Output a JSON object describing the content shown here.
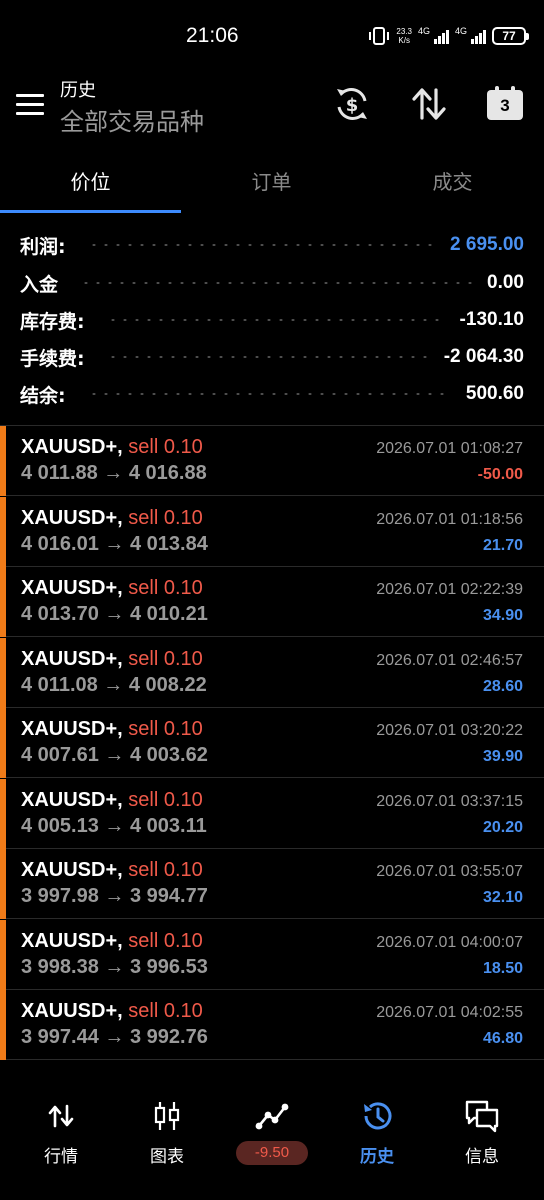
{
  "status_bar": {
    "time": "21:06",
    "speed_value": "23.3",
    "speed_unit": "K/s",
    "network1": "4G",
    "network2": "4G",
    "battery": "77"
  },
  "header": {
    "title": "历史",
    "subtitle": "全部交易品种",
    "icons": [
      "menu-icon",
      "currency-exchange-icon",
      "sort-icon",
      "calendar-icon"
    ],
    "calendar_day": "3"
  },
  "tabs": [
    {
      "label": "价位",
      "active": true
    },
    {
      "label": "订单",
      "active": false
    },
    {
      "label": "成交",
      "active": false
    }
  ],
  "summary": [
    {
      "label": "利润:",
      "value": "2 695.00",
      "color": "#4a90f0"
    },
    {
      "label": "入金",
      "value": "0.00",
      "color": "#ffffff"
    },
    {
      "label": "库存费:",
      "value": "-130.10",
      "color": "#ffffff"
    },
    {
      "label": "手续费:",
      "value": "-2 064.30",
      "color": "#ffffff"
    },
    {
      "label": "结余:",
      "value": "500.60",
      "color": "#ffffff"
    }
  ],
  "trades": [
    {
      "symbol": "XAUUSD+,",
      "side": "sell 0.10",
      "prices": "4 011.88 → 4 016.88",
      "time": "2026.07.01 01:08:27",
      "profit": "-50.00",
      "positive": false
    },
    {
      "symbol": "XAUUSD+,",
      "side": "sell 0.10",
      "prices": "4 016.01 → 4 013.84",
      "time": "2026.07.01 01:18:56",
      "profit": "21.70",
      "positive": true
    },
    {
      "symbol": "XAUUSD+,",
      "side": "sell 0.10",
      "prices": "4 013.70 → 4 010.21",
      "time": "2026.07.01 02:22:39",
      "profit": "34.90",
      "positive": true
    },
    {
      "symbol": "XAUUSD+,",
      "side": "sell 0.10",
      "prices": "4 011.08 → 4 008.22",
      "time": "2026.07.01 02:46:57",
      "profit": "28.60",
      "positive": true
    },
    {
      "symbol": "XAUUSD+,",
      "side": "sell 0.10",
      "prices": "4 007.61 → 4 003.62",
      "time": "2026.07.01 03:20:22",
      "profit": "39.90",
      "positive": true
    },
    {
      "symbol": "XAUUSD+,",
      "side": "sell 0.10",
      "prices": "4 005.13 → 4 003.11",
      "time": "2026.07.01 03:37:15",
      "profit": "20.20",
      "positive": true
    },
    {
      "symbol": "XAUUSD+,",
      "side": "sell 0.10",
      "prices": "3 997.98 → 3 994.77",
      "time": "2026.07.01 03:55:07",
      "profit": "32.10",
      "positive": true
    },
    {
      "symbol": "XAUUSD+,",
      "side": "sell 0.10",
      "prices": "3 998.38 → 3 996.53",
      "time": "2026.07.01 04:00:07",
      "profit": "18.50",
      "positive": true
    },
    {
      "symbol": "XAUUSD+,",
      "side": "sell 0.10",
      "prices": "3 997.44 → 3 992.76",
      "time": "2026.07.01 04:02:55",
      "profit": "46.80",
      "positive": true
    }
  ],
  "colors": {
    "accent_blue": "#4a90f0",
    "sell_red": "#f05a4a",
    "stripe_orange": "#f07b18"
  },
  "bottom_nav": [
    {
      "label": "行情",
      "icon": "quotes-icon",
      "active": false
    },
    {
      "label": "图表",
      "icon": "chart-candles-icon",
      "active": false
    },
    {
      "label": "",
      "icon": "trade-icon",
      "badge": "-9.50",
      "active": false
    },
    {
      "label": "历史",
      "icon": "history-icon",
      "active": true
    },
    {
      "label": "信息",
      "icon": "messages-icon",
      "active": false
    }
  ]
}
